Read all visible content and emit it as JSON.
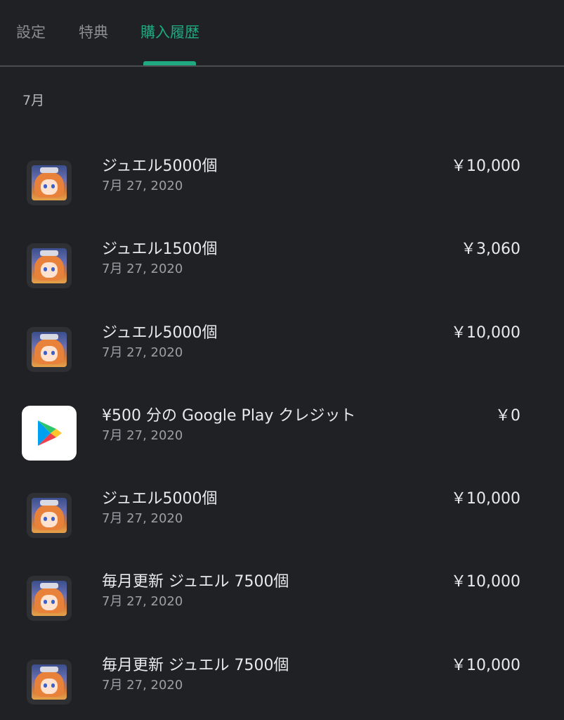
{
  "tabs": [
    {
      "label": "設定"
    },
    {
      "label": "特典"
    },
    {
      "label": "購入履歴"
    }
  ],
  "active_tab": "購入履歴",
  "accent_color": "#1fa882",
  "month_header": "7月",
  "purchases": [
    {
      "title": "ジュエル5000個",
      "date": "7月 27, 2020",
      "price": "￥10,000",
      "icon": "game-app-icon"
    },
    {
      "title": "ジュエル1500個",
      "date": "7月 27, 2020",
      "price": "￥3,060",
      "icon": "game-app-icon"
    },
    {
      "title": "ジュエル5000個",
      "date": "7月 27, 2020",
      "price": "￥10,000",
      "icon": "game-app-icon"
    },
    {
      "title": "¥500 分の Google Play クレジット",
      "date": "7月 27, 2020",
      "price": "￥0",
      "icon": "google-play-icon"
    },
    {
      "title": "ジュエル5000個",
      "date": "7月 27, 2020",
      "price": "￥10,000",
      "icon": "game-app-icon"
    },
    {
      "title": "毎月更新 ジュエル 7500個",
      "date": "7月 27, 2020",
      "price": "￥10,000",
      "icon": "game-app-icon"
    },
    {
      "title": "毎月更新 ジュエル 7500個",
      "date": "7月 27, 2020",
      "price": "￥10,000",
      "icon": "game-app-icon"
    }
  ]
}
